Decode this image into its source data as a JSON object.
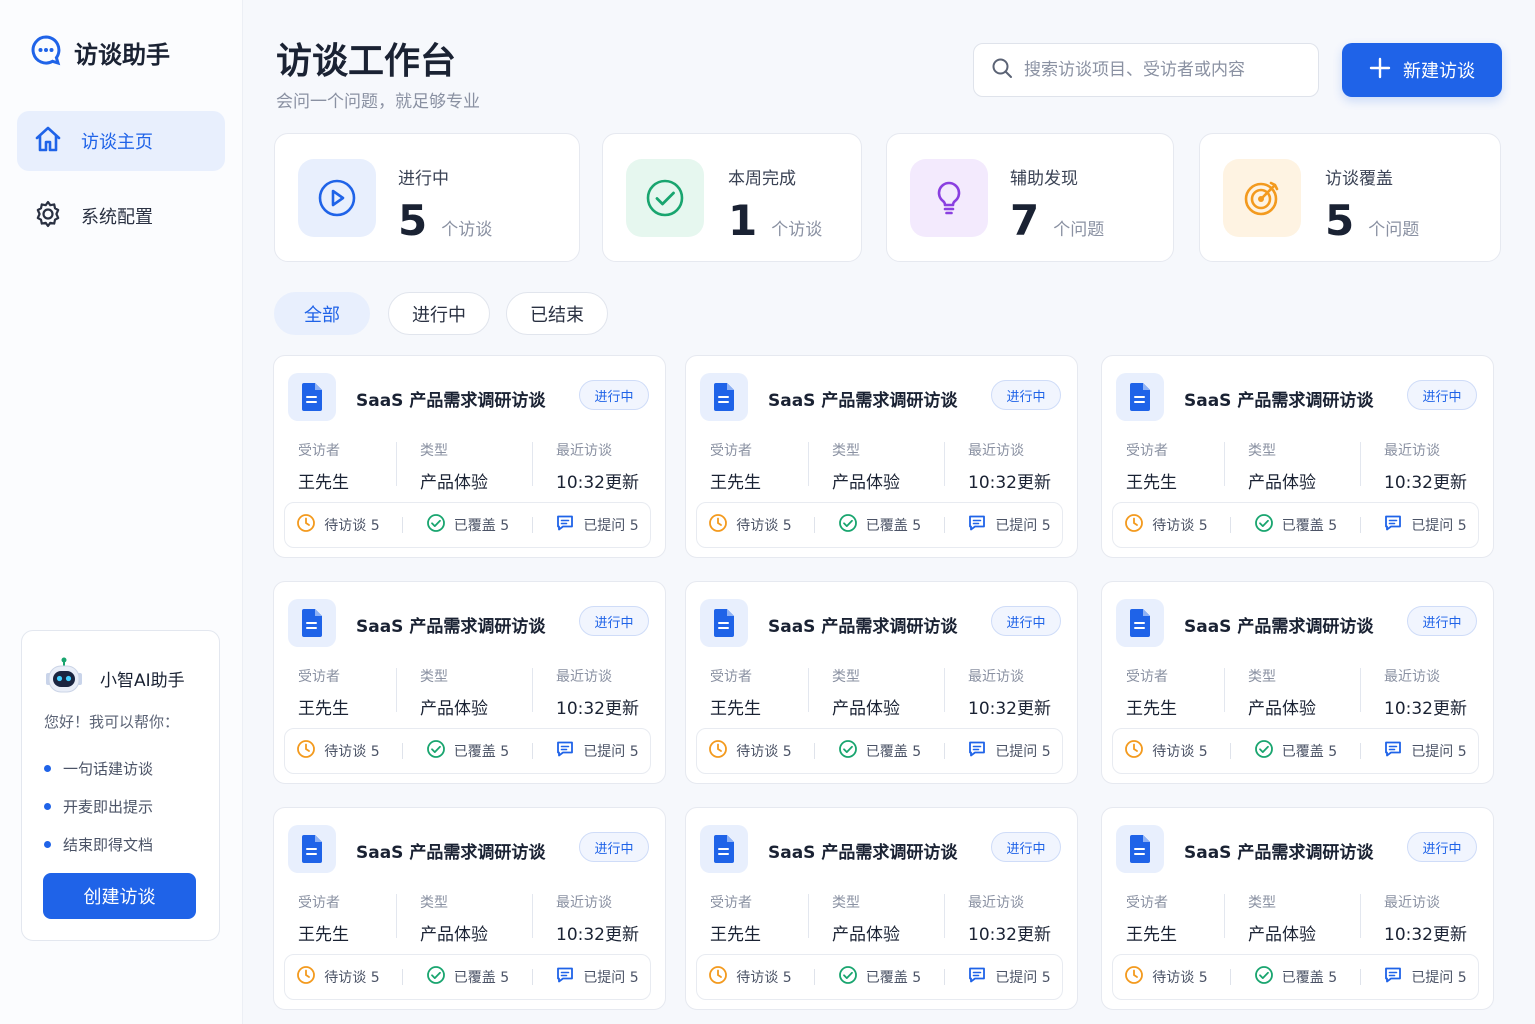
{
  "app": {
    "name": "访谈助手"
  },
  "sidebar": {
    "items": [
      {
        "label": "访谈主页",
        "icon": "home-icon",
        "active": true
      },
      {
        "label": "系统配置",
        "icon": "gear-icon",
        "active": false
      }
    ],
    "assistant": {
      "name": "小智AI助手",
      "greeting": "您好！我可以帮你：",
      "features": [
        "一句话建访谈",
        "开麦即出提示",
        "结束即得文档"
      ],
      "button_label": "创建访谈"
    }
  },
  "header": {
    "title": "访谈工作台",
    "subtitle": "会问一个问题，就足够专业",
    "search_placeholder": "搜索访谈项目、受访者或内容",
    "new_button_label": "新建访谈"
  },
  "stats": [
    {
      "label": "进行中",
      "value": "5",
      "unit": "个访谈",
      "icon": "play-circle-icon",
      "color": "#1f63e8"
    },
    {
      "label": "本周完成",
      "value": "1",
      "unit": "个访谈",
      "icon": "check-circle-icon",
      "color": "#19a56f"
    },
    {
      "label": "辅助发现",
      "value": "7",
      "unit": "个问题",
      "icon": "lightbulb-icon",
      "color": "#8a3fe0"
    },
    {
      "label": "访谈覆盖",
      "value": "5",
      "unit": "个问题",
      "icon": "target-icon",
      "color": "#f39a1e"
    }
  ],
  "filters": [
    {
      "label": "全部",
      "active": true
    },
    {
      "label": "进行中",
      "active": false
    },
    {
      "label": "已结束",
      "active": false
    }
  ],
  "card_labels": {
    "interviewee": "受访者",
    "type": "类型",
    "recent": "最近访谈"
  },
  "cards": [
    {
      "title": "SaaS 产品需求调研访谈",
      "status": "进行中",
      "interviewee": "王先生",
      "type": "产品体验",
      "recent": "10:32更新",
      "pending": "待访谈 5",
      "covered": "已覆盖 5",
      "asked": "已提问 5"
    },
    {
      "title": "SaaS 产品需求调研访谈",
      "status": "进行中",
      "interviewee": "王先生",
      "type": "产品体验",
      "recent": "10:32更新",
      "pending": "待访谈 5",
      "covered": "已覆盖 5",
      "asked": "已提问 5"
    },
    {
      "title": "SaaS 产品需求调研访谈",
      "status": "进行中",
      "interviewee": "王先生",
      "type": "产品体验",
      "recent": "10:32更新",
      "pending": "待访谈 5",
      "covered": "已覆盖 5",
      "asked": "已提问 5"
    },
    {
      "title": "SaaS 产品需求调研访谈",
      "status": "进行中",
      "interviewee": "王先生",
      "type": "产品体验",
      "recent": "10:32更新",
      "pending": "待访谈 5",
      "covered": "已覆盖 5",
      "asked": "已提问 5"
    },
    {
      "title": "SaaS 产品需求调研访谈",
      "status": "进行中",
      "interviewee": "王先生",
      "type": "产品体验",
      "recent": "10:32更新",
      "pending": "待访谈 5",
      "covered": "已覆盖 5",
      "asked": "已提问 5"
    },
    {
      "title": "SaaS 产品需求调研访谈",
      "status": "进行中",
      "interviewee": "王先生",
      "type": "产品体验",
      "recent": "10:32更新",
      "pending": "待访谈 5",
      "covered": "已覆盖 5",
      "asked": "已提问 5"
    },
    {
      "title": "SaaS 产品需求调研访谈",
      "status": "进行中",
      "interviewee": "王先生",
      "type": "产品体验",
      "recent": "10:32更新",
      "pending": "待访谈 5",
      "covered": "已覆盖 5",
      "asked": "已提问 5"
    },
    {
      "title": "SaaS 产品需求调研访谈",
      "status": "进行中",
      "interviewee": "王先生",
      "type": "产品体验",
      "recent": "10:32更新",
      "pending": "待访谈 5",
      "covered": "已覆盖 5",
      "asked": "已提问 5"
    },
    {
      "title": "SaaS 产品需求调研访谈",
      "status": "进行中",
      "interviewee": "王先生",
      "type": "产品体验",
      "recent": "10:32更新",
      "pending": "待访谈 5",
      "covered": "已覆盖 5",
      "asked": "已提问 5"
    }
  ],
  "colors": {
    "accent": "#1f63e8",
    "pending": "#f39a1e",
    "covered": "#19a56f"
  }
}
